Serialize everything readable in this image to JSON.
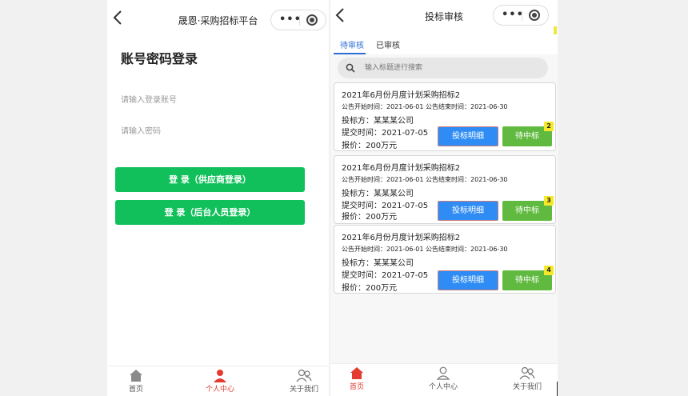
{
  "login": {
    "nav_title": "晟恩·采购招标平台",
    "capsule_dots": "•••",
    "title": "账号密码登录",
    "account_placeholder": "请输入登录账号",
    "password_placeholder": "请输入密码",
    "btn_supplier": "登 录（供应商登录）",
    "btn_admin": "登 录（后台人员登录）",
    "tabbar": [
      {
        "label": "首页",
        "icon": "home-icon"
      },
      {
        "label": "个人中心",
        "icon": "user-icon"
      },
      {
        "label": "关于我们",
        "icon": "group-icon"
      }
    ]
  },
  "bid": {
    "nav_title": "投标审核",
    "capsule_dots": "•••",
    "tabs": [
      "待审核",
      "已审核"
    ],
    "search_placeholder": "输入标题进行搜索",
    "cards": [
      {
        "title": "2021年6月份月度计划采购招标2",
        "dates": "公告开始时间：2021-06-01   公告结束时间：2021-06-30",
        "bidder": "投标方：某某某公司",
        "submit_time": "提交时间：2021-07-05",
        "price": "报价：200万元",
        "detail_btn": "投标明细",
        "win_btn": "待中标",
        "badge": "2"
      },
      {
        "title": "2021年6月份月度计划采购招标2",
        "dates": "公告开始时间：2021-06-01   公告结束时间：2021-06-30",
        "bidder": "投标方：某某某公司",
        "submit_time": "提交时间：2021-07-05",
        "price": "报价：200万元",
        "detail_btn": "投标明细",
        "win_btn": "待中标",
        "badge": "3"
      },
      {
        "title": "2021年6月份月度计划采购招标2",
        "dates": "公告开始时间：2021-06-01   公告结束时间：2021-06-30",
        "bidder": "投标方：某某某公司",
        "submit_time": "提交时间：2021-07-05",
        "price": "报价：200万元",
        "detail_btn": "投标明细",
        "win_btn": "待中标",
        "badge": "4"
      }
    ],
    "tabbar": [
      {
        "label": "首页",
        "icon": "home-icon"
      },
      {
        "label": "个人中心",
        "icon": "user-icon"
      },
      {
        "label": "关于我们",
        "icon": "group-icon"
      }
    ]
  },
  "colors": {
    "green": "#12c05b",
    "blue": "#2f8cf5",
    "win_green": "#5fba3f",
    "active_red": "#e33b2f",
    "badge_yellow": "#f7e92a"
  }
}
